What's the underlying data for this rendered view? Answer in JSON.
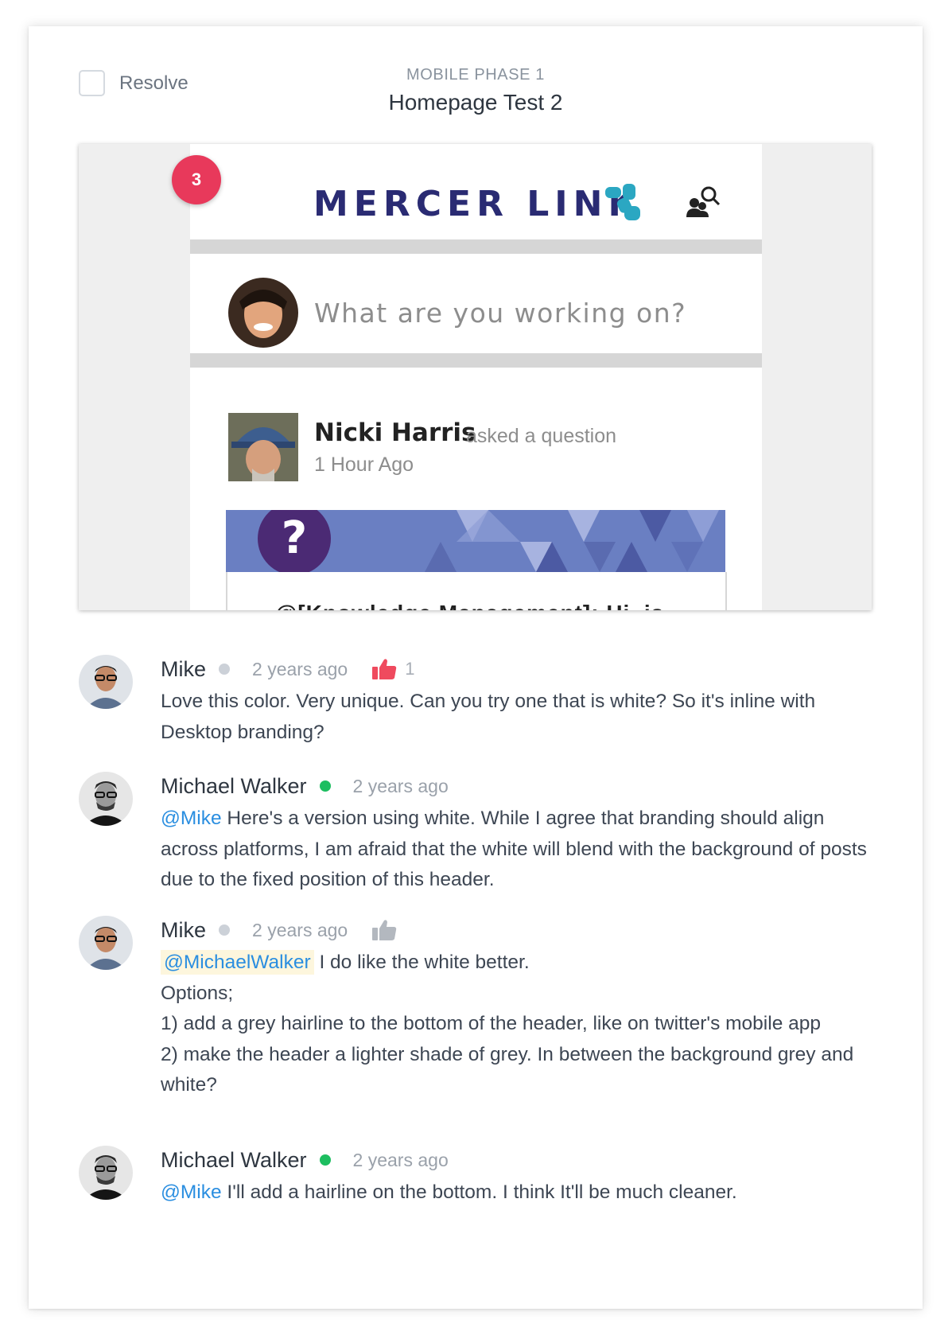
{
  "header": {
    "resolve_label": "Resolve",
    "phase": "MOBILE PHASE 1",
    "title": "Homepage Test 2"
  },
  "preview": {
    "pin_number": "3",
    "app_brand": "MERCER LINK",
    "compose_placeholder": "What are you working on?",
    "post": {
      "author": "Nicki Harris",
      "action": "asked a question",
      "time": "1 Hour Ago",
      "snippet": "@[Knowledge Management]: Hi, is"
    },
    "colors": {
      "brand": "#2a2b73",
      "brand_mark": "#2ba7c2",
      "banner": "#6a7fc2",
      "question_badge": "#4b2a74"
    }
  },
  "comments": [
    {
      "author": "Mike",
      "status": "offline",
      "status_color": "#ccd1d8",
      "time": "2 years ago",
      "likes": "1",
      "liked": true,
      "text": "Love this color. Very unique. Can you try one that is white? So it's inline with Desktop branding?"
    },
    {
      "author": "Michael Walker",
      "status": "online",
      "status_color": "#1dbe60",
      "time": "2 years ago",
      "mention": "@Mike",
      "text": "Here's a version using white. While I agree that branding should align across platforms, I am afraid that the white will blend with the background of posts due to the fixed position of this header."
    },
    {
      "author": "Mike",
      "status": "offline",
      "status_color": "#ccd1d8",
      "time": "2 years ago",
      "liked": false,
      "mention": "@MichaelWalker",
      "text_first": "I do like the white better.",
      "lines": [
        "Options;",
        "1) add a grey hairline to the bottom of the header, like on twitter's mobile app",
        "2) make the header a lighter shade of grey. In between the background grey and white?"
      ]
    },
    {
      "author": "Michael Walker",
      "status": "online",
      "status_color": "#1dbe60",
      "time": "2 years ago",
      "mention": "@Mike",
      "text": "I'll add a hairline on the bottom. I think It'll be much cleaner."
    }
  ],
  "colors": {
    "like_active": "#ef4a5e",
    "like_inactive": "#b3b8bf",
    "mention": "#2a8ee0",
    "pin": "#e8395b"
  }
}
